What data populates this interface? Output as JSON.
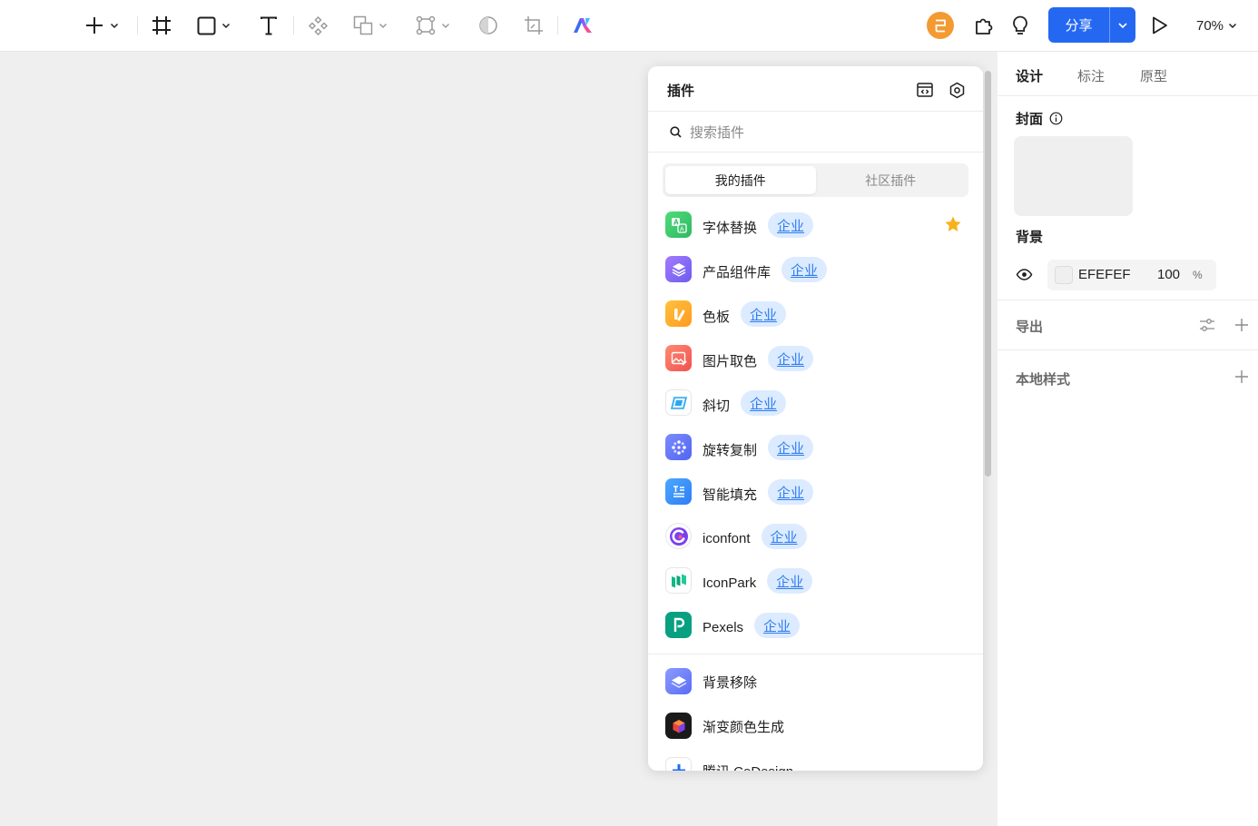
{
  "toolbar": {
    "tools": [
      {
        "name": "add-tool",
        "icon": "plus-icon"
      },
      {
        "name": "frame-tool",
        "icon": "frame-icon"
      },
      {
        "name": "shape-tool",
        "icon": "rectangle-icon"
      },
      {
        "name": "text-tool",
        "icon": "text-icon"
      },
      {
        "name": "component-tool",
        "icon": "component-icon"
      },
      {
        "name": "boolean-tool",
        "icon": "boolean-icon"
      },
      {
        "name": "vector-network-tool",
        "icon": "vector-icon"
      },
      {
        "name": "mask-tool",
        "icon": "mask-icon"
      },
      {
        "name": "crop-tool",
        "icon": "crop-icon"
      },
      {
        "name": "ai-tool",
        "icon": "ai-logo-icon"
      }
    ],
    "avatar_initial": "己",
    "share_label": "分享",
    "zoom_label": "70%",
    "accent_color": "#2468f2"
  },
  "plugin_panel": {
    "title": "插件",
    "search_placeholder": "搜索插件",
    "tabs": [
      {
        "label": "我的插件",
        "active": true
      },
      {
        "label": "社区插件",
        "active": false
      }
    ],
    "items": [
      {
        "name": "字体替换",
        "badge": "企业",
        "starred": true
      },
      {
        "name": "产品组件库",
        "badge": "企业"
      },
      {
        "name": "色板",
        "badge": "企业"
      },
      {
        "name": "图片取色",
        "badge": "企业"
      },
      {
        "name": "斜切",
        "badge": "企业"
      },
      {
        "name": "旋转复制",
        "badge": "企业"
      },
      {
        "name": "智能填充",
        "badge": "企业"
      },
      {
        "name": "iconfont",
        "badge": "企业"
      },
      {
        "name": "IconPark",
        "badge": "企业"
      },
      {
        "name": "Pexels",
        "badge": "企业"
      },
      {
        "name": "背景移除"
      },
      {
        "name": "渐变颜色生成"
      },
      {
        "name": "腾讯 CoDesign"
      }
    ]
  },
  "right_panel": {
    "tabs": [
      "设计",
      "标注",
      "原型"
    ],
    "active_tab": "设计",
    "cover_title": "封面",
    "background_title": "背景",
    "background": {
      "hex": "EFEFEF",
      "opacity": "100",
      "percent": "%"
    },
    "export_title": "导出",
    "local_styles_title": "本地样式"
  }
}
